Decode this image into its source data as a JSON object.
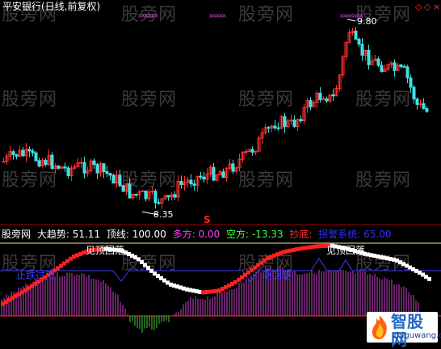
{
  "window": {
    "title": "平安银行(日线,前复权)",
    "controls": [
      "◇",
      "◇",
      "×"
    ]
  },
  "watermark": {
    "text": "股旁网"
  },
  "price_chart": {
    "high_label": "9.80",
    "low_label": "8.35",
    "signal_marker": "S",
    "colors": {
      "up": "#ff3030",
      "down": "#40e0e0",
      "signal": "#cc44cc",
      "label": "#ffffff"
    }
  },
  "indicator": {
    "name": "股旁网",
    "items": [
      {
        "label": "大趋势:",
        "value": "51.11",
        "color": "#ffffff"
      },
      {
        "label": "顶线:",
        "value": "100.00",
        "color": "#ffffff"
      },
      {
        "label": "多方:",
        "value": "0.00",
        "color": "#ff40ff"
      },
      {
        "label": "空方:",
        "value": "-13.33",
        "color": "#40ff40"
      },
      {
        "label": "抄底:",
        "value": "",
        "color": "#ff3030"
      },
      {
        "label": "拐警系统:",
        "value": "65.00",
        "color": "#3030ff"
      }
    ],
    "annotations": {
      "top_escape_1": "见顶回落",
      "top_escape_2": "见顶回落",
      "bottom_left": "止跌过顶",
      "mid": "涨回落"
    },
    "colors": {
      "trend_up": "#ff2020",
      "trend_flat": "#ffffff",
      "bars_pos": "#cc44cc",
      "bars_neg": "#44cc44",
      "guide": "#3a3aff",
      "topline": "#e8e8a0"
    }
  },
  "logo": {
    "title": "智股网",
    "url": "zhiguwang.com"
  }
}
